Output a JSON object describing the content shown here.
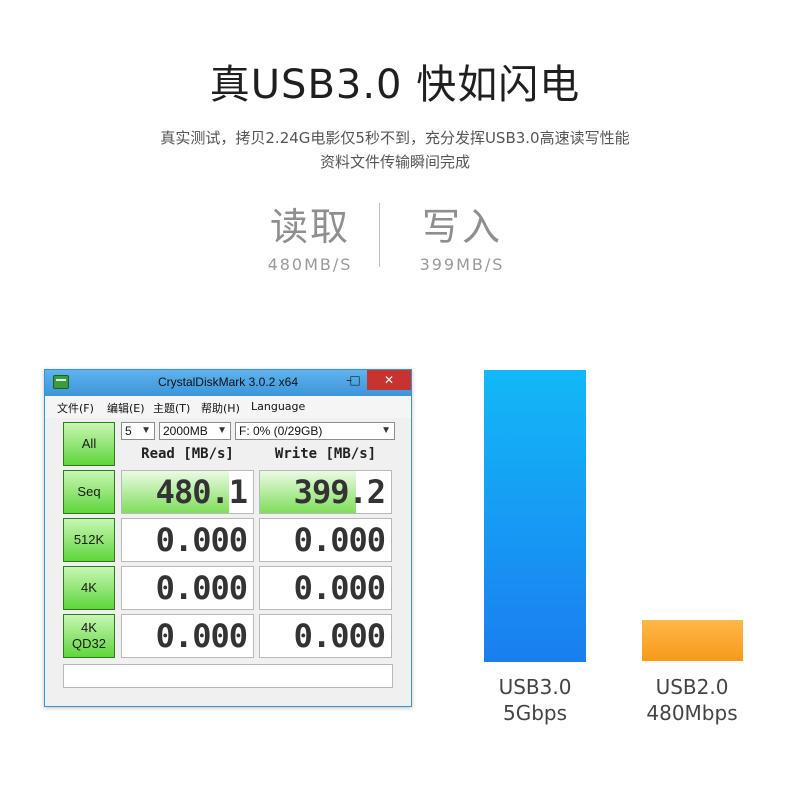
{
  "header": {
    "title": "真USB3.0 快如闪电",
    "subtitle_line1": "真实测试，拷贝2.24G电影仅5秒不到，充分发挥USB3.0高速读写性能",
    "subtitle_line2": "资料文件传输瞬间完成"
  },
  "stats": {
    "read": {
      "label": "读取",
      "value": "480MB/S"
    },
    "write": {
      "label": "写入",
      "value": "399MB/S"
    }
  },
  "window": {
    "title": "CrystalDiskMark 3.0.2 x64",
    "controls": {
      "minimize": "–",
      "maximize": "□",
      "close": "✕"
    },
    "menu": [
      "文件(F)",
      "编辑(E)",
      "主题(T)",
      "帮助(H)",
      "Language"
    ],
    "all_button": "All",
    "count_select": "5",
    "size_select": "2000MB",
    "drive_select": "F: 0% (0/29GB)",
    "columns": {
      "read": "Read [MB/s]",
      "write": "Write [MB/s]"
    },
    "rows": [
      {
        "label1": "Seq",
        "label2": "",
        "read": "480.1",
        "write": "399.2",
        "read_fill": 0.82,
        "write_fill": 0.73
      },
      {
        "label1": "512K",
        "label2": "",
        "read": "0.000",
        "write": "0.000",
        "read_fill": 0,
        "write_fill": 0
      },
      {
        "label1": "4K",
        "label2": "",
        "read": "0.000",
        "write": "0.000",
        "read_fill": 0,
        "write_fill": 0
      },
      {
        "label1": "4K",
        "label2": "QD32",
        "read": "0.000",
        "write": "0.000",
        "read_fill": 0,
        "write_fill": 0
      }
    ],
    "status_text": ""
  },
  "comparison": {
    "usb3": {
      "line1": "USB3.0",
      "line2": "5Gbps",
      "color": "#1a9cf5"
    },
    "usb2": {
      "line1": "USB2.0",
      "line2": "480Mbps",
      "color": "#f7a52c"
    }
  }
}
